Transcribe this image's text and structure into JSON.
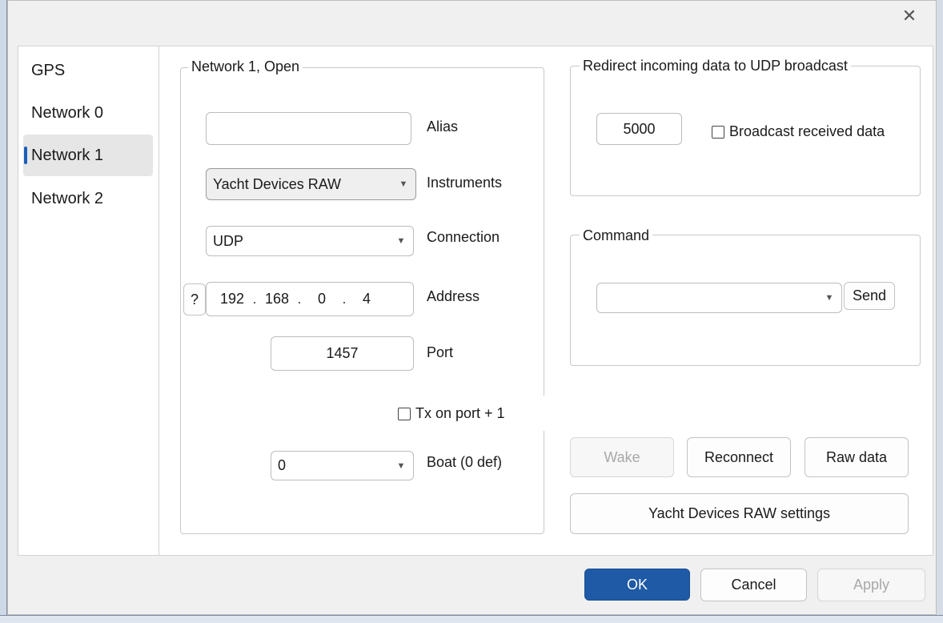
{
  "window": {
    "close_glyph": "✕"
  },
  "sidebar": {
    "items": [
      {
        "label": "GPS"
      },
      {
        "label": "Network 0"
      },
      {
        "label": "Network 1"
      },
      {
        "label": "Network 2"
      }
    ],
    "selected_index": 2
  },
  "network_group": {
    "title": "Network 1, Open",
    "alias": {
      "label": "Alias",
      "value": ""
    },
    "instruments": {
      "label": "Instruments",
      "value": "Yacht Devices RAW"
    },
    "connection": {
      "label": "Connection",
      "value": "UDP"
    },
    "address": {
      "label": "Address",
      "help": "?",
      "octets": [
        "192",
        "168",
        "0",
        "4"
      ],
      "separator": "."
    },
    "port": {
      "label": "Port",
      "value": "1457"
    },
    "tx_port": {
      "label": "Tx on port + 1",
      "checked": false
    },
    "boat": {
      "label": "Boat (0 def)",
      "value": "0"
    }
  },
  "redirect_group": {
    "title": "Redirect incoming data to UDP broadcast",
    "port_value": "5000",
    "broadcast": {
      "label": "Broadcast received data",
      "checked": false
    }
  },
  "command_group": {
    "title": "Command",
    "value": "",
    "send_label": "Send"
  },
  "actions": {
    "wake": "Wake",
    "reconnect": "Reconnect",
    "raw_data": "Raw data",
    "settings": "Yacht Devices RAW settings"
  },
  "footer": {
    "ok": "OK",
    "cancel": "Cancel",
    "apply": "Apply"
  },
  "colors": {
    "accent": "#1f5aa6",
    "selection_indicator": "#1f5fb8"
  }
}
